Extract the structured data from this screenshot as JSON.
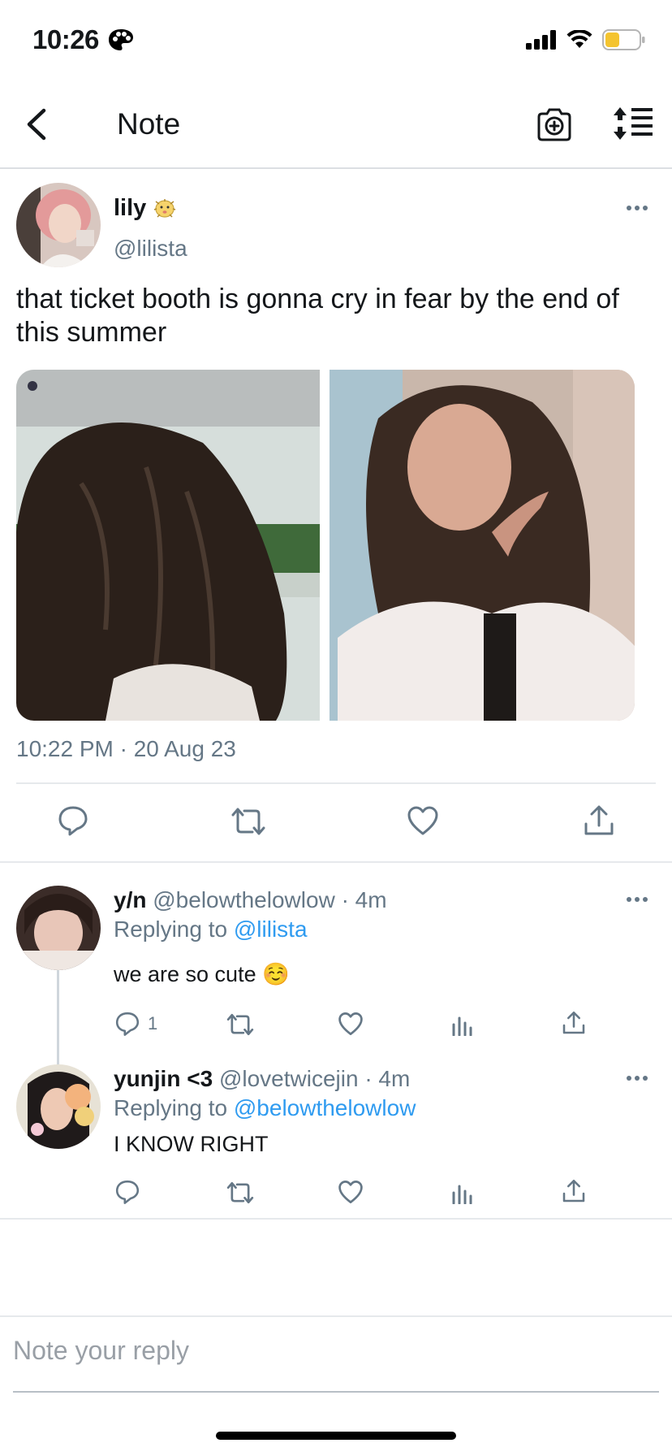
{
  "status_bar": {
    "time": "10:26",
    "icons": [
      "palette-icon",
      "signal-icon",
      "wifi-icon",
      "battery-icon"
    ]
  },
  "nav": {
    "title": "Note",
    "icons": [
      "back-chevron-icon",
      "camera-add-icon",
      "sort-list-icon"
    ]
  },
  "main_post": {
    "author_name": "lily",
    "author_emoji": "pufferfish-emoji",
    "author_handle": "@lilista",
    "text": "that ticket booth is gonna cry in fear by the end of this summer",
    "media": [
      "photo of long dark hair in car",
      "photo of girl smiling pointing at face"
    ],
    "timestamp": "10:22 PM · 20 Aug 23",
    "actions": [
      "reply-icon",
      "retweet-icon",
      "like-icon",
      "share-icon"
    ]
  },
  "replies": [
    {
      "name": "y/n",
      "handle": "@belowthelowlow",
      "time": "· 4m",
      "replying_prefix": "Replying to ",
      "replying_handle": "@lilista",
      "text": "we are so cute ☺️",
      "reply_count": "1"
    },
    {
      "name": "yunjin <3",
      "handle": "@lovetwicejin",
      "time": "· 4m",
      "replying_prefix": "Replying to ",
      "replying_handle": "@belowthelowlow",
      "text": "I KNOW RIGHT",
      "reply_count": ""
    }
  ],
  "compose": {
    "placeholder": "Note your reply"
  },
  "colors": {
    "link": "#2f9bf0",
    "secondary_text": "#657786",
    "primary_text": "#14171a",
    "battery": "#f4c430"
  }
}
